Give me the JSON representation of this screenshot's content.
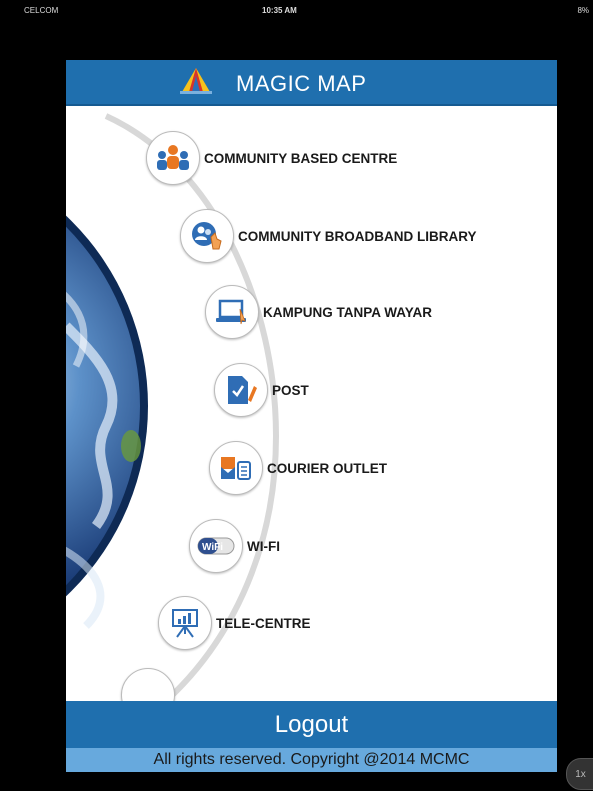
{
  "status_bar": {
    "carrier": "CELCOM",
    "time": "10:35 AM",
    "battery": "8%"
  },
  "header": {
    "title": "MAGIC MAP",
    "logo_icon": "triangle-logo-icon"
  },
  "menu": {
    "items": [
      {
        "label": "COMMUNITY BASED CENTRE",
        "icon": "people-group-icon"
      },
      {
        "label": "COMMUNITY BROADBAND LIBRARY",
        "icon": "user-touch-icon"
      },
      {
        "label": "KAMPUNG TANPA WAYAR",
        "icon": "laptop-icon"
      },
      {
        "label": "POST",
        "icon": "document-pen-icon"
      },
      {
        "label": "COURIER OUTLET",
        "icon": "package-document-icon"
      },
      {
        "label": "WI-FI",
        "icon": "wifi-badge-icon",
        "icon_text": "WiFi"
      },
      {
        "label": "TELE-CENTRE",
        "icon": "presentation-board-icon"
      }
    ]
  },
  "logout": {
    "label": "Logout"
  },
  "footer": {
    "text": "All rights reserved. Copyright @2014 MCMC"
  },
  "zoom_badge": {
    "label": "1x"
  },
  "colors": {
    "header_blue": "#1f6fae",
    "footer_light_blue": "#67a9dd"
  }
}
